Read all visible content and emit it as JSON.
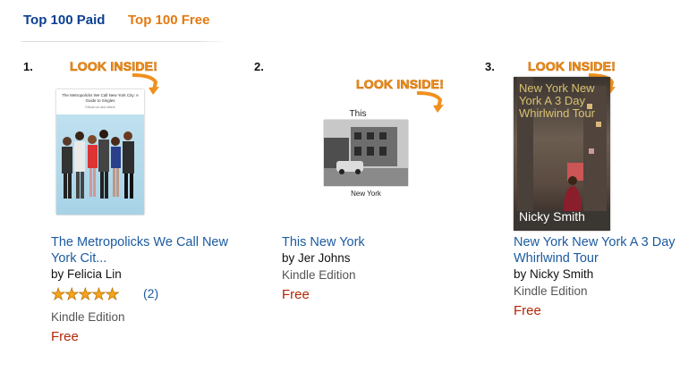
{
  "tabs": [
    {
      "label": "Top 100 Paid",
      "active": false
    },
    {
      "label": "Top 100 Free",
      "active": true
    }
  ],
  "accent_color": "#e47911",
  "look_inside": "LOOK INSIDE!",
  "items": [
    {
      "rank": "1.",
      "title": "The Metropolicks We Call New York Cit...",
      "author": "by Felicia Lin",
      "rating": 5,
      "review_count": "(2)",
      "format": "Kindle Edition",
      "price": "Free",
      "cover": {
        "heading": "The Metropolicks We Call New York City: A Guide to Singles",
        "subheading": "Felicia Lin and others"
      }
    },
    {
      "rank": "2.",
      "title": "This New York",
      "author": "by Jer Johns",
      "format": "Kindle Edition",
      "price": "Free",
      "cover": {
        "top_text": "This",
        "bottom_text": "New York"
      }
    },
    {
      "rank": "3.",
      "title": "New York New York A 3 Day Whirlwind Tour",
      "author": "by Nicky Smith",
      "format": "Kindle Edition",
      "price": "Free",
      "cover": {
        "title_text": "New York New York A 3 Day Whirlwind Tour",
        "author_text": "Nicky Smith"
      }
    }
  ]
}
